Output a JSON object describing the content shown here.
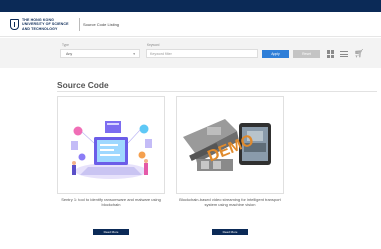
{
  "header": {
    "logo_text": "THE HONG KONG UNIVERSITY OF SCIENCE AND TECHNOLOGY",
    "title": "Source Code Listing"
  },
  "filters": {
    "category_label": "Type",
    "category_value": "Any",
    "keyword_label": "Keyword",
    "keyword_placeholder": "Keyword filter",
    "apply_label": "Apply",
    "reset_label": "Reset"
  },
  "section": {
    "title": "Source Code"
  },
  "cards": [
    {
      "image_icon": "laptop-network-illustration",
      "description": "Sentry 1: tool to identify ransomware and malware using blockchain",
      "button_label": "Read More"
    },
    {
      "image_icon": "demo-machine-vision-illustration",
      "description": "Blockchain-based video streaming for intelligent transport system using machine vision",
      "button_label": "Read More",
      "watermark": "DEMO"
    }
  ],
  "colors": {
    "brand_navy": "#0b2a57",
    "apply_blue": "#2e7ed8",
    "reset_gray": "#c4c4c4",
    "filter_bg": "#f3f3f3"
  }
}
